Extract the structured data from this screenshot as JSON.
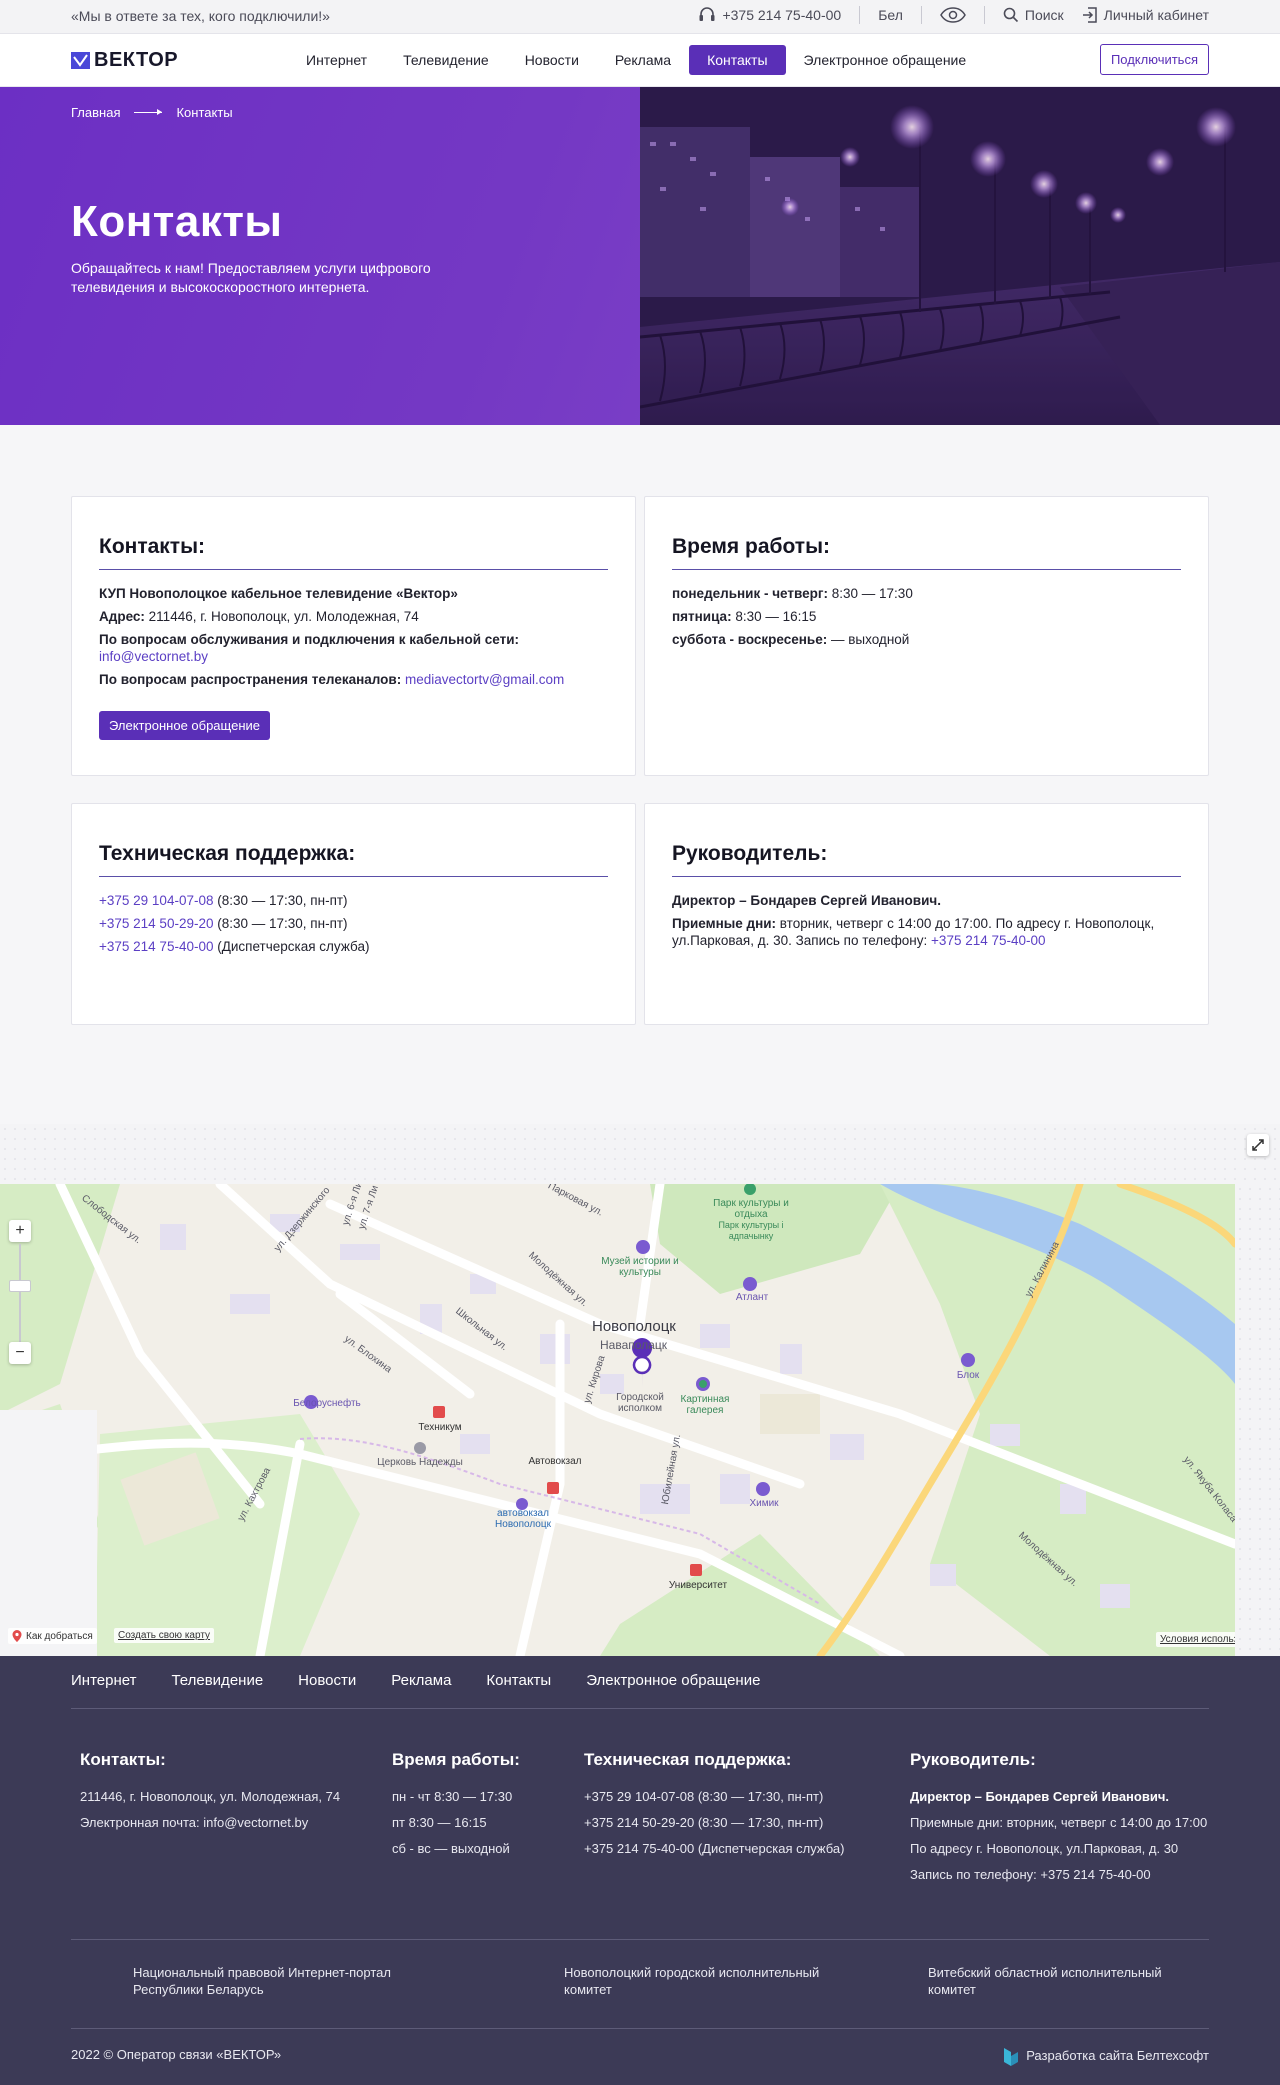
{
  "topbar": {
    "slogan": "«Мы в ответе за тех, кого подключили!»",
    "phone": "+375 214 75-40-00",
    "lang": "Бел",
    "search": "Поиск",
    "cabinet": "Личный кабинет"
  },
  "header": {
    "logo": "ВЕКТОР",
    "nav": [
      "Интернет",
      "Телевидение",
      "Новости",
      "Реклама",
      "Контакты",
      "Электронное обращение"
    ],
    "active_nav": "Контакты",
    "connect": "Подключиться"
  },
  "hero": {
    "breadcrumb_home": "Главная",
    "breadcrumb_current": "Контакты",
    "title": "Контакты",
    "subtitle": "Обращайтесь к нам! Предоставляем услуги цифрового телевидения и высокоскоростного интернета."
  },
  "contacts": {
    "title": "Контакты:",
    "org": "КУП Новополоцкое кабельное телевидение «Вектор»",
    "address_label": "Адрес:",
    "address": "211446, г. Новополоцк, ул. Молодежная, 74",
    "service_label": "По вопросам обслуживания и подключения к кабельной сети:",
    "service_email": "info@vectornet.by",
    "channels_label": "По вопросам распространения телеканалов:",
    "channels_email": "mediavectortv@gmail.com",
    "appeal_button": "Электронное обращение"
  },
  "hours": {
    "title": "Время работы:",
    "rows": [
      {
        "label": "понедельник - четверг:",
        "value": "8:30 — 17:30"
      },
      {
        "label": "пятница:",
        "value": "8:30 — 16:15"
      },
      {
        "label": "суббота - воскресенье:",
        "value": "— выходной"
      }
    ]
  },
  "support": {
    "title": "Техническая поддержка:",
    "rows": [
      {
        "phone": "+375 29 104-07-08",
        "note": "(8:30 — 17:30, пн-пт)"
      },
      {
        "phone": "+375 214 50-29-20",
        "note": "(8:30 — 17:30, пн-пт)"
      },
      {
        "phone": "+375 214 75-40-00",
        "note": "(Диспетчерская служба)"
      }
    ]
  },
  "director": {
    "title": "Руководитель:",
    "name": "Директор – Бондарев Сергей Иванович.",
    "reception_label": "Приемные дни:",
    "reception": "вторник, четверг с 14:00 до 17:00. По адресу г. Новополоцк, ул.Парковая, д. 30. Запись по телефону:",
    "reception_phone": "+375 214 75-40-00"
  },
  "map": {
    "city": "Новополоцк",
    "city_by": "Наваполацк",
    "pin_label": "Городской исполком",
    "how_to": "Как добраться",
    "create_map": "Создать свою карту",
    "terms": "Условия использования",
    "streets": [
      "Слободская ул.",
      "ул. Дзержинского",
      "ул. 6-я Ли",
      "ул. 7-я Ли",
      "Парковая ул.",
      "Молодёжная ул.",
      "Школьная ул.",
      "ул. Блохина",
      "ул. Кирова",
      "Юбилейная ул.",
      "ул. Калинина",
      "ул. Якуба Коласа",
      "ул. Кахтрова",
      "Молодёжная ул."
    ],
    "pois": [
      "Парк культуры и отдыха",
      "Парк культуры і адпачынку",
      "Музей истории и культуры",
      "Атлант",
      "Картинная галерея",
      "Белоруснефть",
      "Техникум",
      "Церковь Надежды",
      "Автовокзал",
      "автовокзал Новополоцк",
      "Химик",
      "Университет",
      "Блок"
    ]
  },
  "footer": {
    "nav": [
      "Интернет",
      "Телевидение",
      "Новости",
      "Реклама",
      "Контакты",
      "Электронное обращение"
    ],
    "contacts_title": "Контакты:",
    "contacts_address": "211446, г. Новополоцк, ул. Молодежная, 74",
    "contacts_email": "Электронная почта: info@vectornet.by",
    "hours_title": "Время работы:",
    "hours": [
      "пн - чт 8:30 — 17:30",
      "пт 8:30 — 16:15",
      "сб - вс — выходной"
    ],
    "support_title": "Техническая поддержка:",
    "support": [
      "+375 29 104-07-08 (8:30 — 17:30, пн-пт)",
      "+375 214 50-29-20 (8:30 — 17:30, пн-пт)",
      "+375 214 75-40-00 (Диспетчерская служба)"
    ],
    "director_title": "Руководитель:",
    "director_name": "Директор – Бондарев Сергей Иванович.",
    "director_lines": [
      "Приемные дни: вторник, четверг с 14:00 до 17:00",
      "По адресу г. Новополоцк, ул.Парковая, д. 30",
      "Запись по телефону: +375 214 75-40-00"
    ],
    "partners": [
      "Национальный правовой Интернет-портал Республики Беларусь",
      "Новополоцкий городской исполнительный комитет",
      "Витебский областной исполнительный комитет"
    ],
    "copyright": "2022 © Оператор связи «ВЕКТОР»",
    "developer": "Разработка сайта Белтехсофт"
  },
  "colors": {
    "brand": "#5a2fb7",
    "footer_bg": "#3c3a56",
    "link": "#5b3fc4"
  }
}
